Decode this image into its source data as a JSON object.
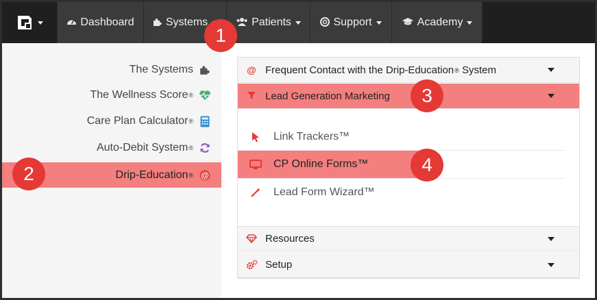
{
  "navbar": {
    "items": [
      {
        "label": "Dashboard",
        "icon": "dashboard-gauge-icon"
      },
      {
        "label": "Systems",
        "icon": "puzzle-icon"
      },
      {
        "label": "Patients",
        "icon": "users-icon"
      },
      {
        "label": "Support",
        "icon": "lifebuoy-icon"
      },
      {
        "label": "Academy",
        "icon": "graduation-cap-icon"
      }
    ]
  },
  "sidebar": {
    "items": [
      {
        "label": "The Systems",
        "reg": "",
        "icon": "puzzle-icon"
      },
      {
        "label": "The Wellness Score",
        "reg": "®",
        "icon": "heartbeat-icon"
      },
      {
        "label": "Care Plan Calculator",
        "reg": "®",
        "icon": "calculator-icon"
      },
      {
        "label": "Auto-Debit System",
        "reg": "®",
        "icon": "refresh-icon"
      },
      {
        "label": "Drip-Education",
        "reg": "®",
        "icon": "at-icon"
      }
    ]
  },
  "accordion": {
    "headers": [
      {
        "pre": "Frequent Contact with the Drip-Education",
        "reg": "®",
        "post": " System"
      },
      {
        "pre": "Lead Generation Marketing",
        "reg": "",
        "post": ""
      },
      {
        "pre": "Resources",
        "reg": "",
        "post": ""
      },
      {
        "pre": "Setup",
        "reg": "",
        "post": ""
      }
    ],
    "sub_items": [
      {
        "label": "Link Trackers™",
        "icon": "cursor-pointer-icon"
      },
      {
        "label": "CP Online Forms™",
        "icon": "monitor-icon"
      },
      {
        "label": "Lead Form Wizard™",
        "icon": "magic-wand-icon"
      }
    ]
  },
  "badges": [
    "1",
    "2",
    "3",
    "4"
  ],
  "colors": {
    "highlight": "#f47f7f",
    "badge": "#e53935",
    "icon_red": "#e53935"
  }
}
